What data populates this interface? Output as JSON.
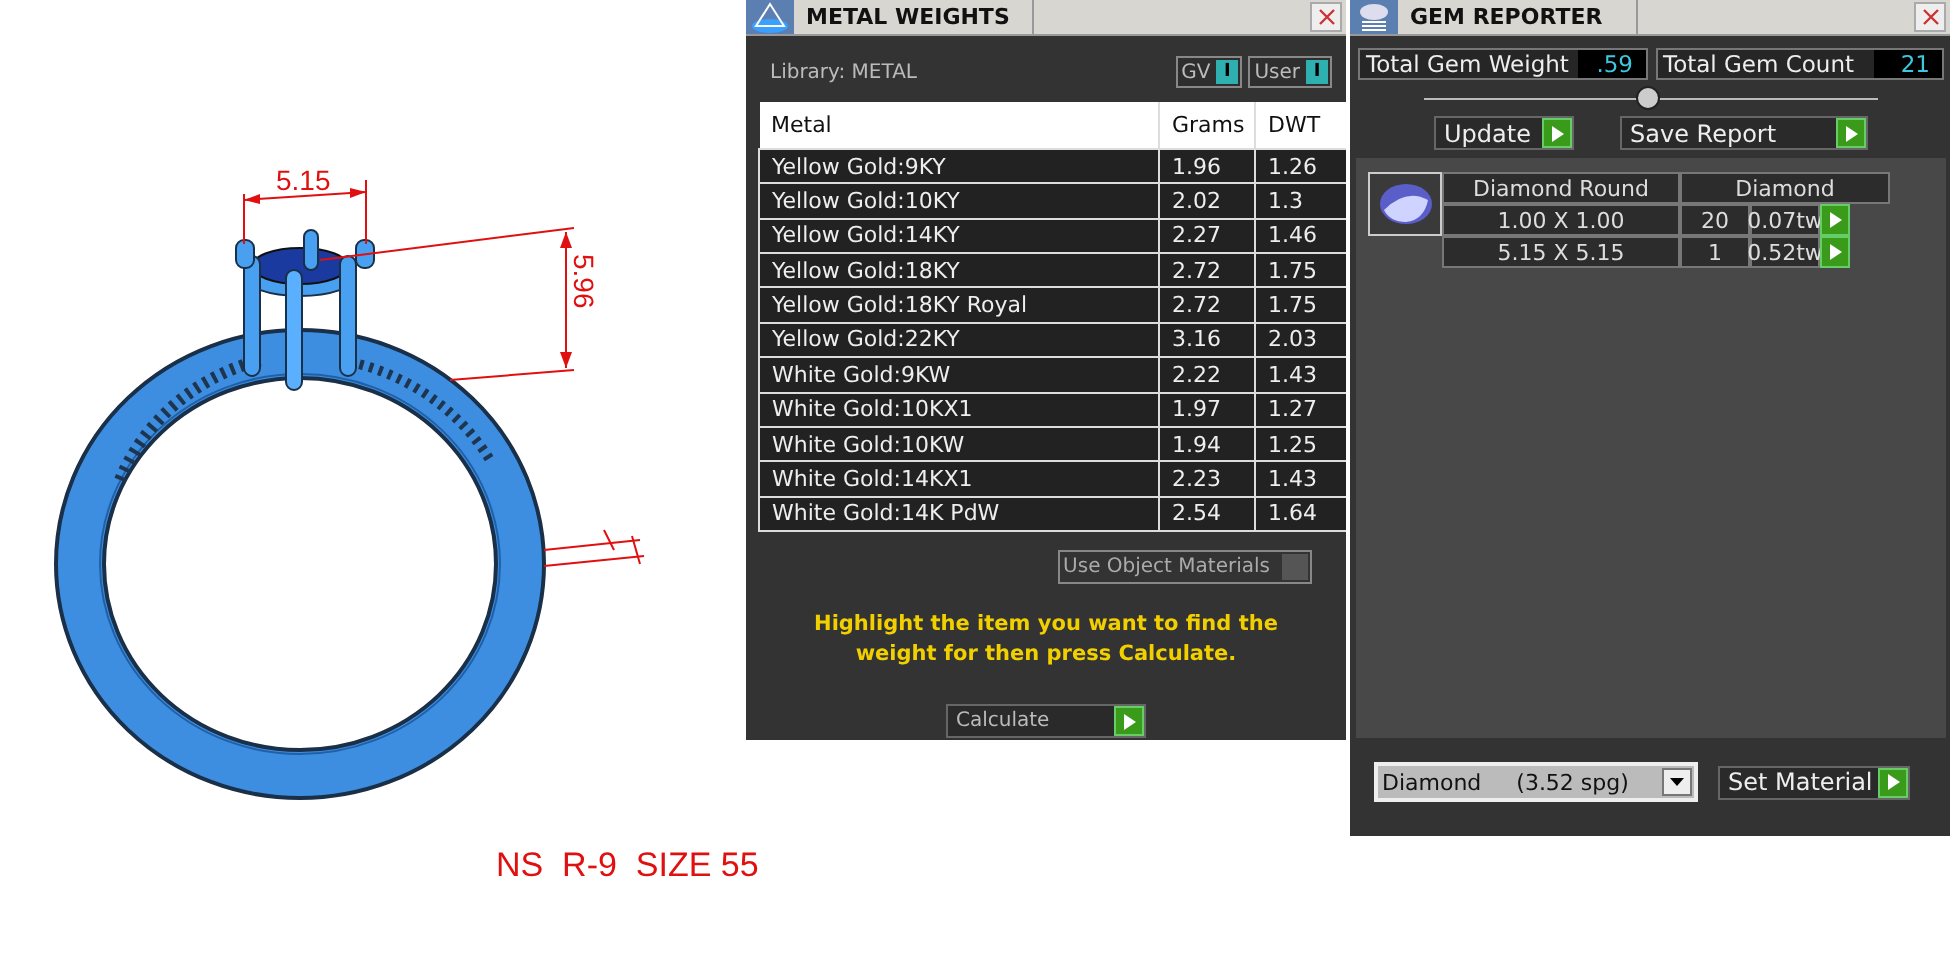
{
  "drawing": {
    "width_label": "5.15",
    "height_label": "5.96",
    "caption": "NS  R-9  SIZE 55"
  },
  "metal_weights": {
    "title": "METAL WEIGHTS",
    "library_label": "Library: METAL",
    "toggles": [
      {
        "label": "GV",
        "on": true,
        "mark": "I"
      },
      {
        "label": "User",
        "on": true,
        "mark": "I"
      }
    ],
    "columns": [
      "Metal",
      "Grams",
      "DWT"
    ],
    "rows": [
      {
        "metal": "Yellow Gold:9KY",
        "grams": "1.96",
        "dwt": "1.26"
      },
      {
        "metal": "Yellow Gold:10KY",
        "grams": "2.02",
        "dwt": "1.3"
      },
      {
        "metal": "Yellow Gold:14KY",
        "grams": "2.27",
        "dwt": "1.46"
      },
      {
        "metal": "Yellow Gold:18KY",
        "grams": "2.72",
        "dwt": "1.75"
      },
      {
        "metal": "Yellow Gold:18KY Royal",
        "grams": "2.72",
        "dwt": "1.75"
      },
      {
        "metal": "Yellow Gold:22KY",
        "grams": "3.16",
        "dwt": "2.03"
      },
      {
        "metal": "White Gold:9KW",
        "grams": "2.22",
        "dwt": "1.43"
      },
      {
        "metal": "White Gold:10KX1",
        "grams": "1.97",
        "dwt": "1.27"
      },
      {
        "metal": "White Gold:10KW",
        "grams": "1.94",
        "dwt": "1.25"
      },
      {
        "metal": "White Gold:14KX1",
        "grams": "2.23",
        "dwt": "1.43"
      },
      {
        "metal": "White Gold:14K PdW",
        "grams": "2.54",
        "dwt": "1.64"
      }
    ],
    "use_object_materials": {
      "label": "Use Object Materials",
      "checked": false
    },
    "hint": "Highlight the item you want to find the weight for then press Calculate.",
    "calculate_button": "Calculate"
  },
  "gem_reporter": {
    "title": "GEM REPORTER",
    "totals": [
      {
        "label": "Total Gem Weight",
        "value": ".59"
      },
      {
        "label": "Total Gem Count",
        "value": "21"
      }
    ],
    "buttons": [
      "Update",
      "Save Report"
    ],
    "gem_table": {
      "columns": [
        "Diamond Round",
        "Diamond"
      ],
      "rows": [
        {
          "size": "1.00 X 1.00",
          "count": "20",
          "weight": "0.07tw"
        },
        {
          "size": "5.15 X 5.15",
          "count": "1",
          "weight": "0.52tw"
        }
      ]
    },
    "material_dropdown": "Diamond     (3.52 spg)",
    "set_material_button": "Set Material"
  }
}
